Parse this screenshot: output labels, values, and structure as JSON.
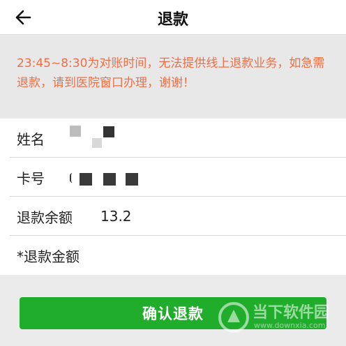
{
  "header": {
    "title": "退款",
    "back_icon": "arrow-left-icon"
  },
  "notice": {
    "text": "23:45~8:30为对账时间，无法提供线上退款业务，如急需退款，请到医院窗口办理，谢谢！",
    "color": "#ec6f46"
  },
  "form": {
    "rows": [
      {
        "label": "姓名",
        "value": ""
      },
      {
        "label": "卡号",
        "value": ""
      },
      {
        "label": "退款余额",
        "value": "13.2"
      },
      {
        "label": "*退款金额",
        "value": ""
      }
    ]
  },
  "submit": {
    "label": "确认退款",
    "color": "#21ad2c"
  },
  "watermark": {
    "title": "当下软件园",
    "url": "www.downxia.com"
  }
}
